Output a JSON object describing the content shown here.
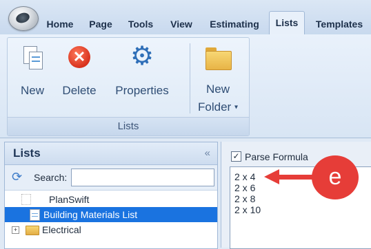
{
  "tabs": [
    "Home",
    "Page",
    "Tools",
    "View",
    "Estimating",
    "Lists",
    "Templates"
  ],
  "ribbon": {
    "group_caption": "Lists",
    "buttons": {
      "new": "New",
      "delete": "Delete",
      "properties": "Properties",
      "new_folder_line1": "New",
      "new_folder_line2": "Folder",
      "dropdown_glyph": "▾"
    }
  },
  "lists_panel": {
    "title": "Lists",
    "collapse_glyph": "«",
    "search_label": "Search:",
    "search_value": "",
    "tree": {
      "root": "PlanSwift",
      "selected": "Building Materials List",
      "folder": "Electrical",
      "expander_glyph": "+"
    }
  },
  "formula_panel": {
    "parse_formula_label": "Parse Formula",
    "parse_formula_checked": true,
    "check_glyph": "✓",
    "lines": [
      "2 x 4",
      "2 x 6",
      "2 x 8",
      "2 x 10"
    ]
  },
  "callout": {
    "letter": "e",
    "color": "#e63d38"
  },
  "icons": {
    "refresh": "⟳",
    "gear": "⚙",
    "close": "✕"
  }
}
